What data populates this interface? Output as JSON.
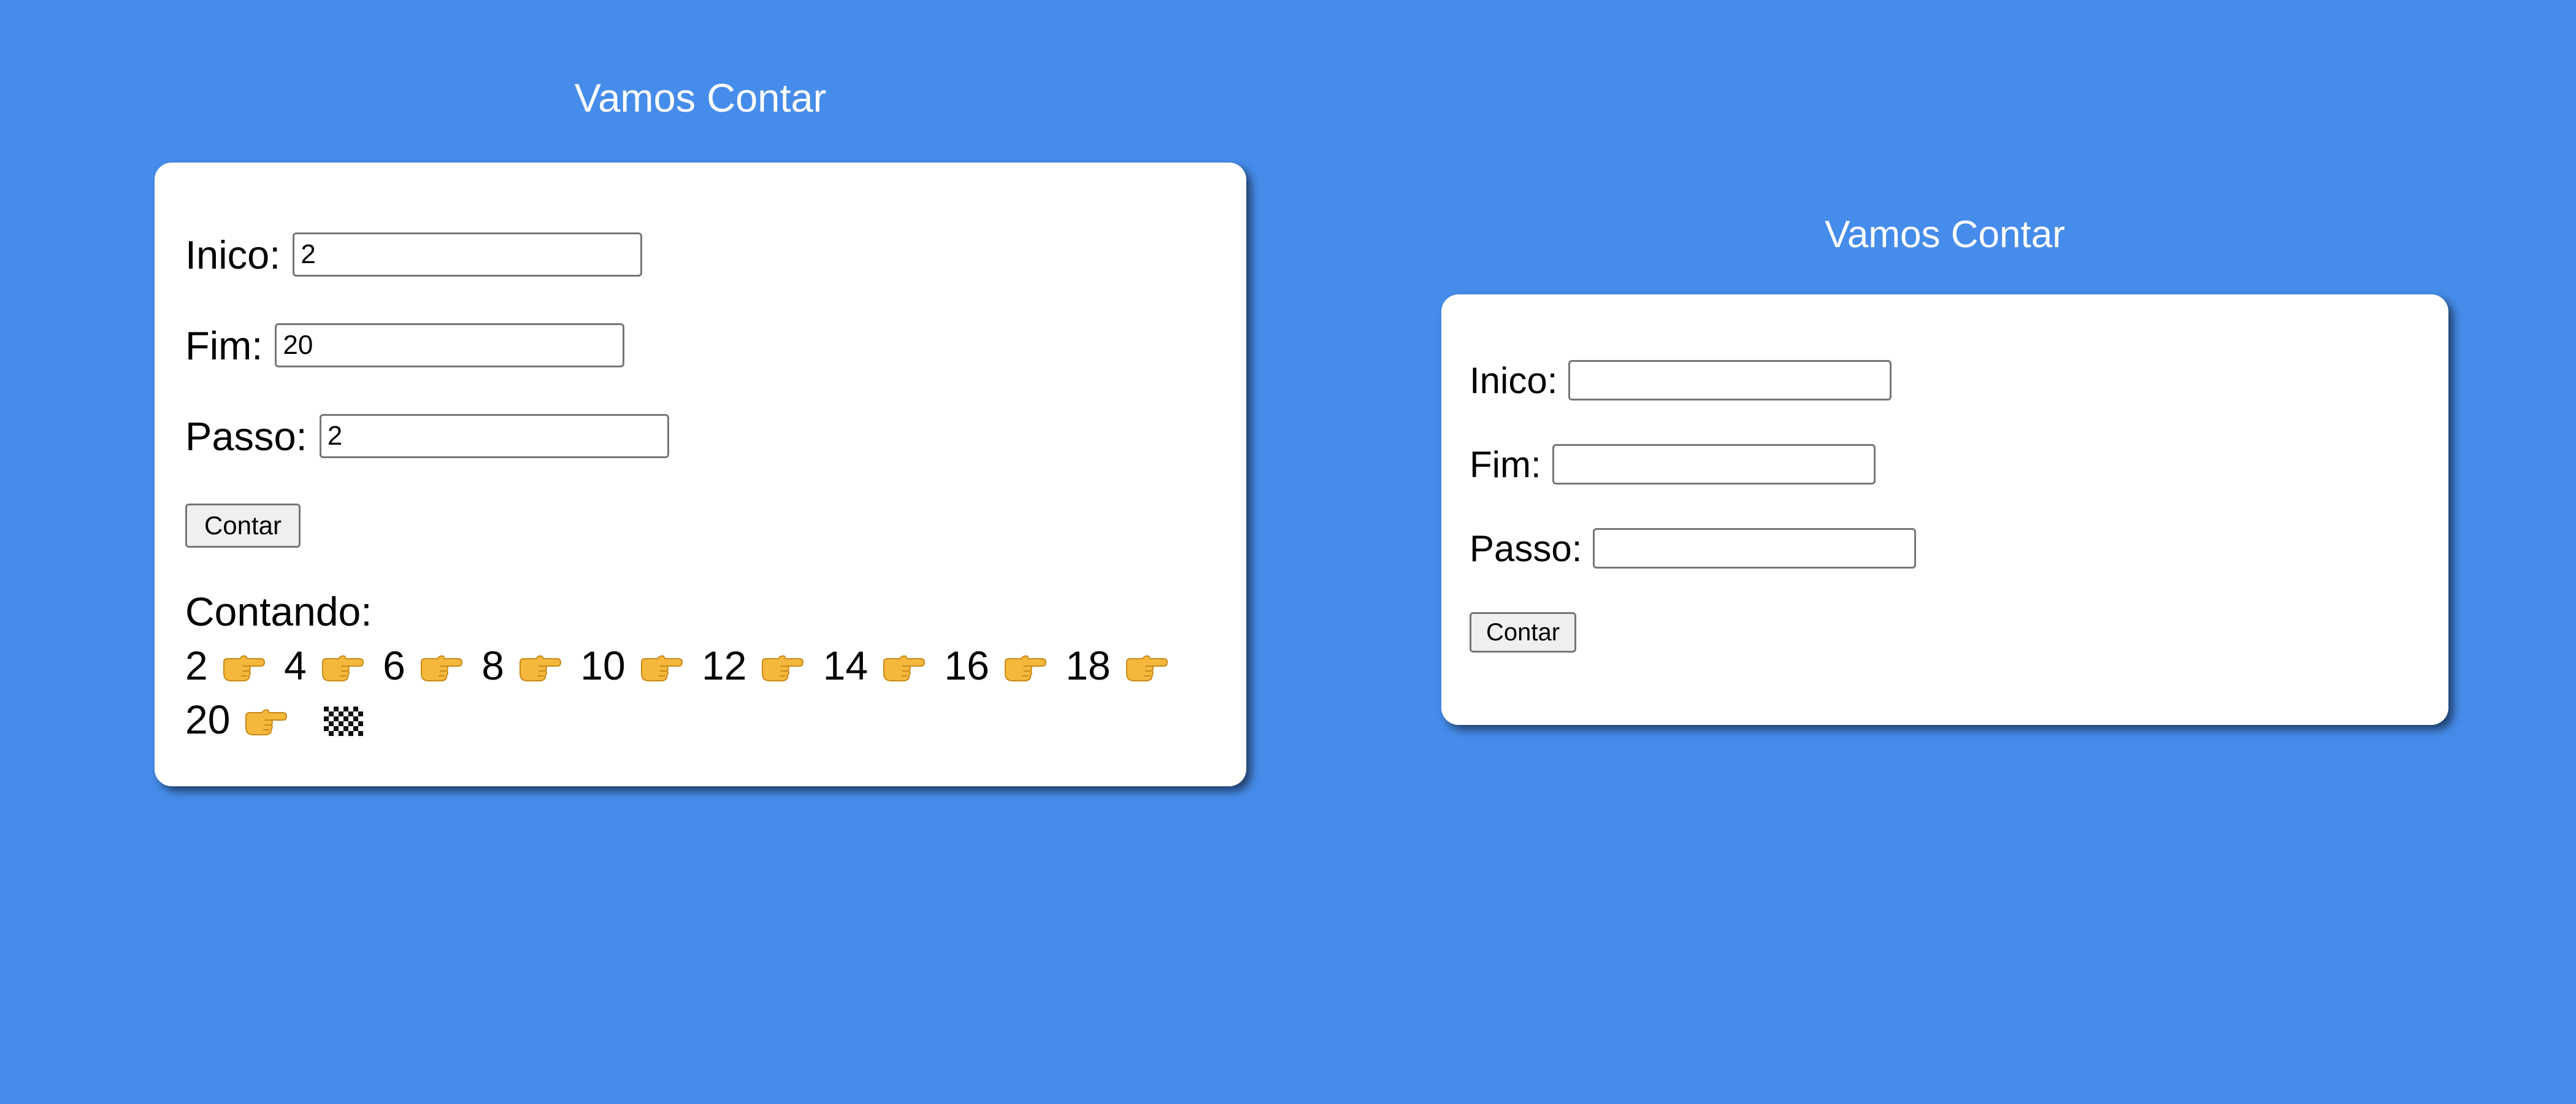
{
  "colors": {
    "background": "#468cea",
    "card": "#ffffff",
    "title_text": "#ffffff",
    "button_bg": "#efefef",
    "pointer_hand": "#f5b83d"
  },
  "left_panel": {
    "title": "Vamos Contar",
    "form": {
      "inicio_label": "Inico:",
      "inicio_value": "2",
      "fim_label": "Fim:",
      "fim_value": "20",
      "passo_label": "Passo:",
      "passo_value": "2",
      "button_label": "Contar"
    },
    "result": {
      "title": "Contando:",
      "sequence": [
        "2",
        "4",
        "6",
        "8",
        "10",
        "12",
        "14",
        "16",
        "18",
        "20"
      ],
      "separator_icon": "pointing-right-hand-icon",
      "end_icon": "checkered-flag-icon"
    }
  },
  "right_panel": {
    "title": "Vamos Contar",
    "form": {
      "inicio_label": "Inico:",
      "inicio_value": "",
      "fim_label": "Fim:",
      "fim_value": "",
      "passo_label": "Passo:",
      "passo_value": "",
      "button_label": "Contar"
    }
  }
}
